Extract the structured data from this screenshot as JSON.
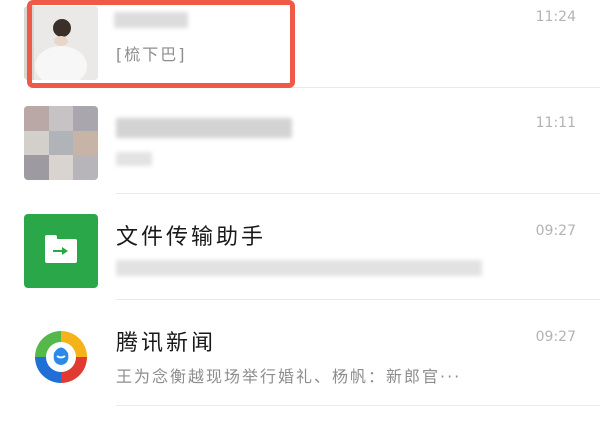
{
  "chats": [
    {
      "id": "chat-1",
      "name": "",
      "preview": "[梳下巴]",
      "time": "11:24",
      "avatar": "person-photo"
    },
    {
      "id": "chat-2",
      "name": "",
      "preview": "",
      "time": "11:11",
      "avatar": "group-photo-grid"
    },
    {
      "id": "chat-3",
      "name": "文件传输助手",
      "preview": "",
      "time": "09:27",
      "avatar": "file-transfer-icon"
    },
    {
      "id": "chat-4",
      "name": "腾讯新闻",
      "preview": "王为念衡越现场举行婚礼、杨帆：新郎官···",
      "time": "09:27",
      "avatar": "tencent-news-icon"
    }
  ],
  "colors": {
    "highlight": "#ee5a45",
    "file_transfer_green": "#2aa849",
    "time_gray": "#b3b3b3",
    "preview_gray": "#8d8d8d"
  }
}
